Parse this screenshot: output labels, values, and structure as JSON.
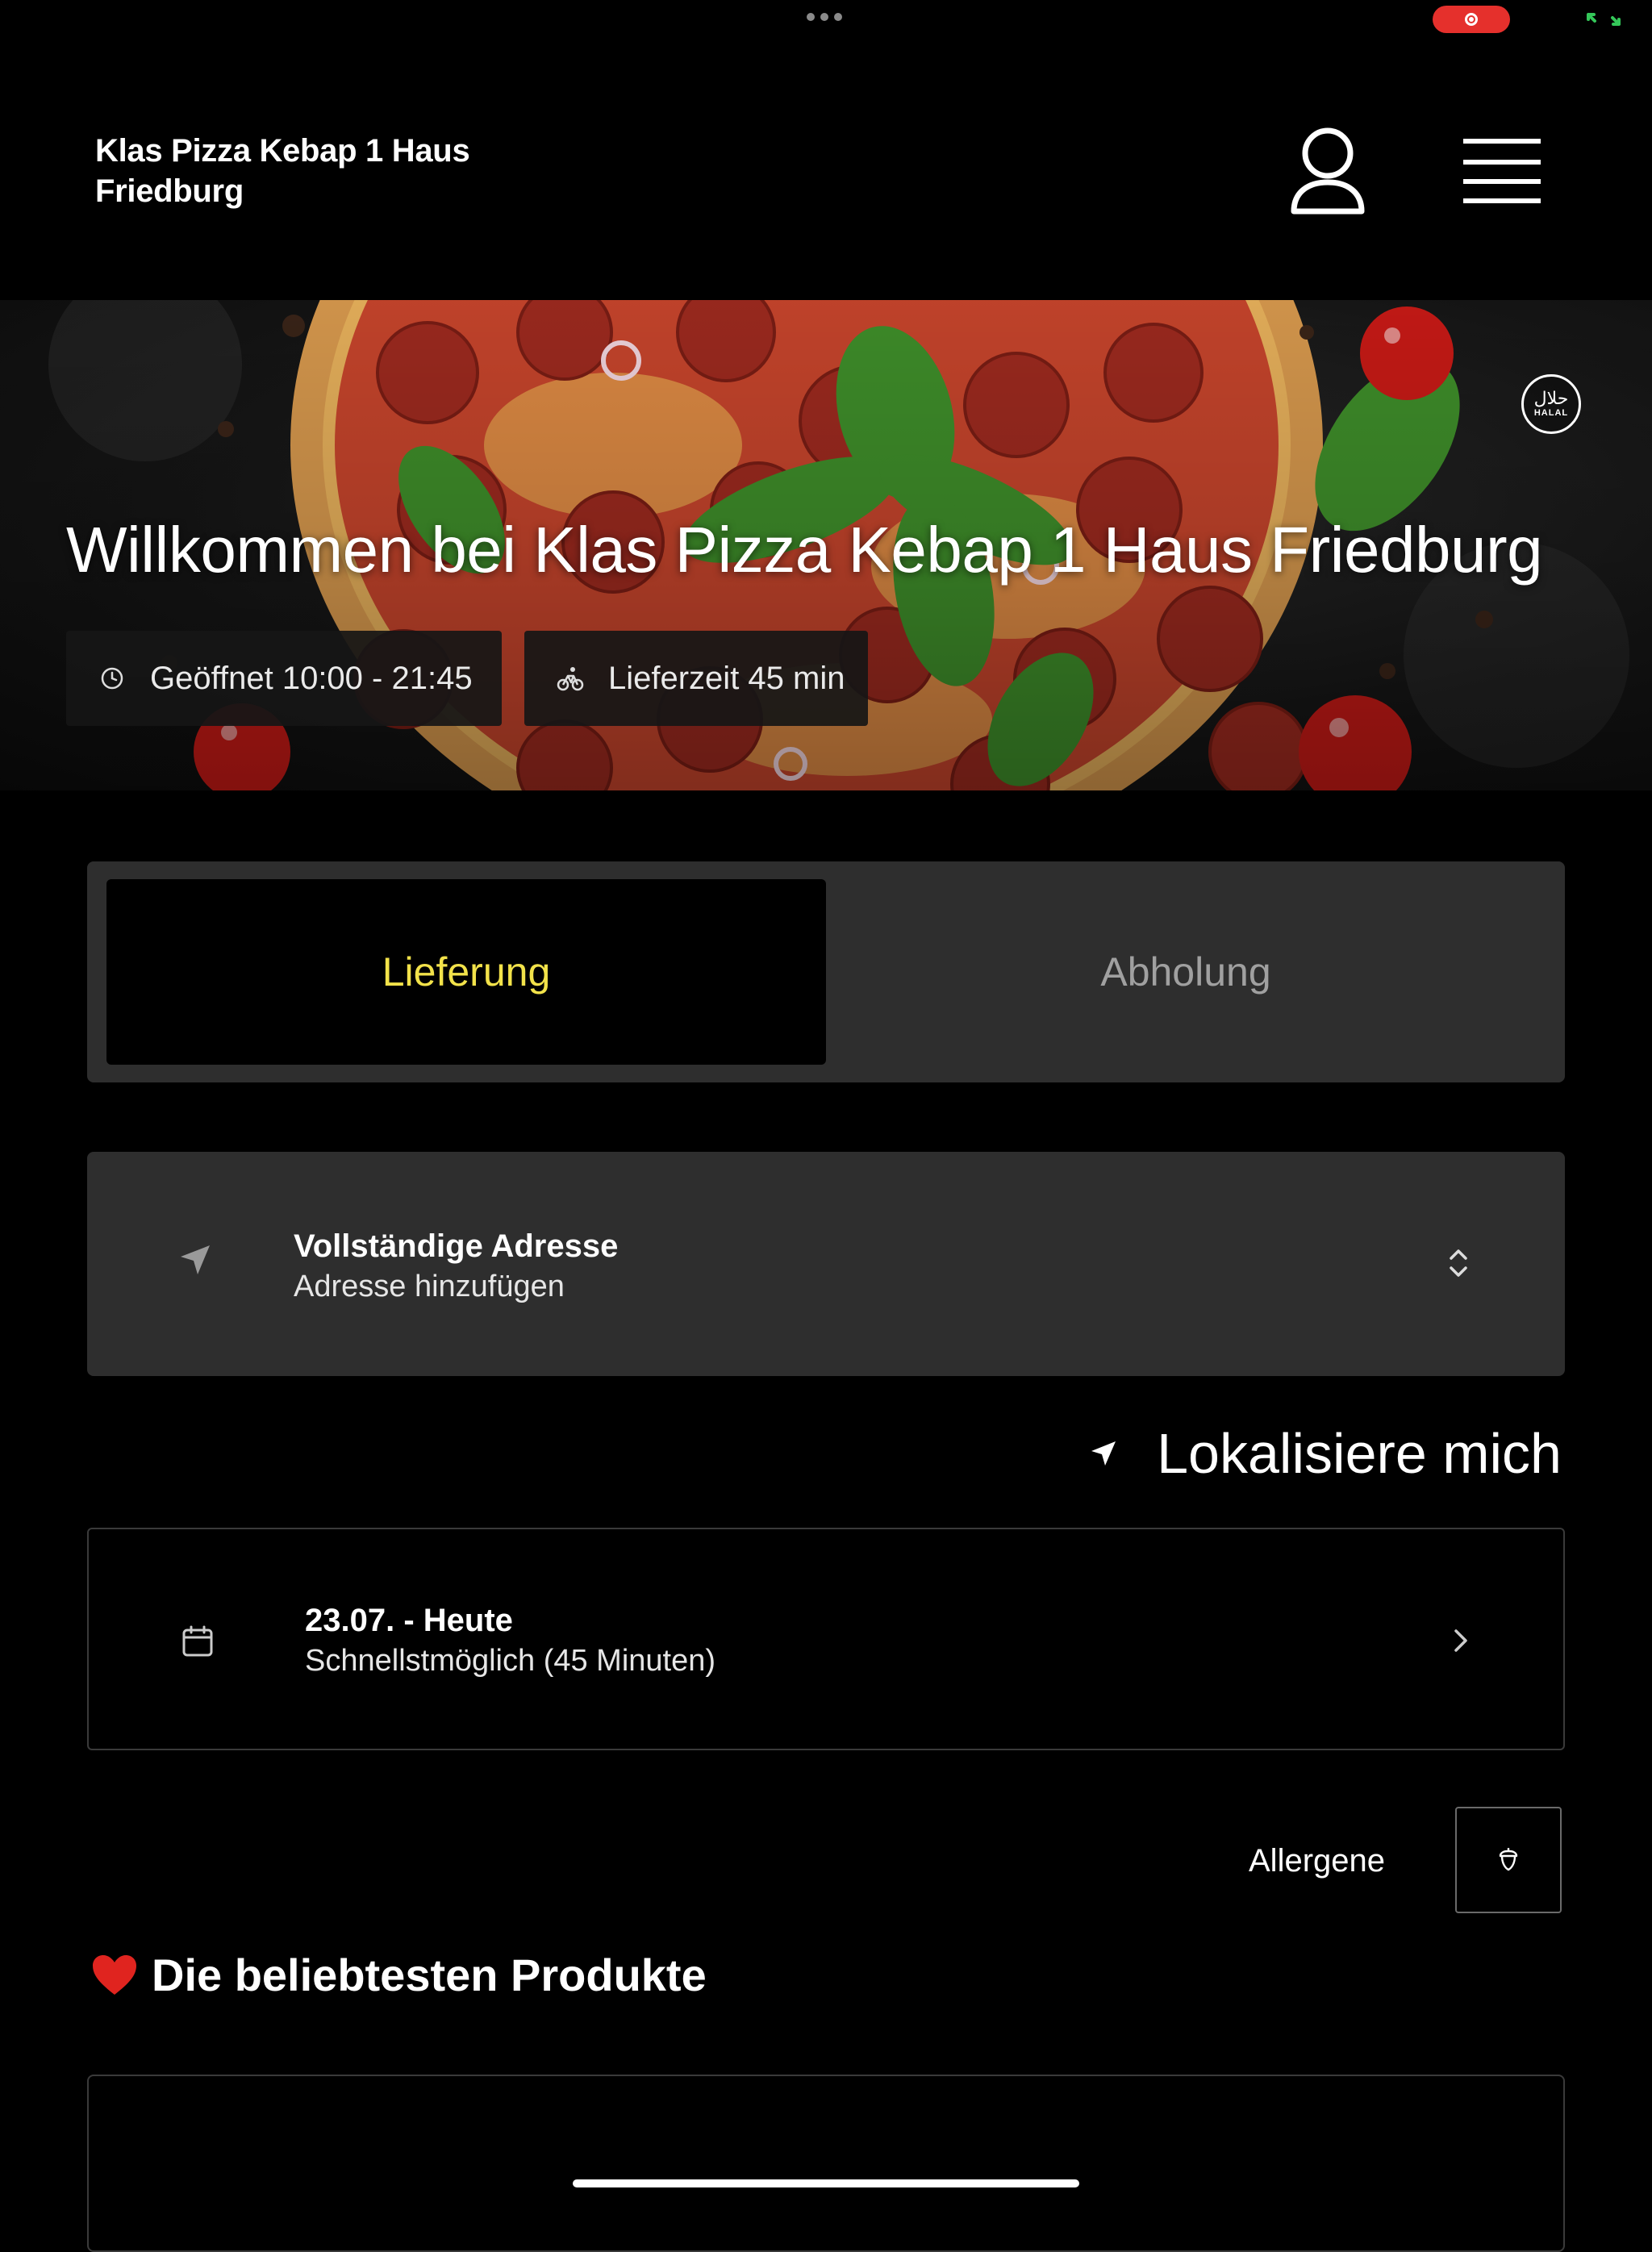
{
  "header": {
    "title": "Klas Pizza Kebap 1 Haus Friedburg",
    "profile_icon": "user-icon",
    "menu_icon": "hamburger-menu-icon"
  },
  "hero": {
    "headline": "Willkommen bei Klas Pizza Kebap 1 Haus Friedburg",
    "halal_badge": {
      "arabic": "حلال",
      "latin": "HALAL"
    },
    "opening_hours": "Geöffnet 10:00 - 21:45",
    "delivery_time": "Lieferzeit 45 min"
  },
  "order_mode": {
    "tabs": [
      {
        "label": "Lieferung",
        "active": true
      },
      {
        "label": "Abholung",
        "active": false
      }
    ],
    "active_color": "#f2e24a"
  },
  "address": {
    "title": "Vollständige Adresse",
    "placeholder": "Adresse hinzufügen"
  },
  "locate": {
    "label": "Lokalisiere mich"
  },
  "schedule": {
    "date": "23.07. - Heute",
    "time": "Schnellstmöglich (45 Minuten)"
  },
  "allergens": {
    "label": "Allergene"
  },
  "popular": {
    "emoji": "❤️",
    "title": "Die beliebtesten Produkte"
  },
  "colors": {
    "background": "#000000",
    "card": "#2e2e2e",
    "accent": "#f2e24a",
    "record": "#e5302c"
  }
}
